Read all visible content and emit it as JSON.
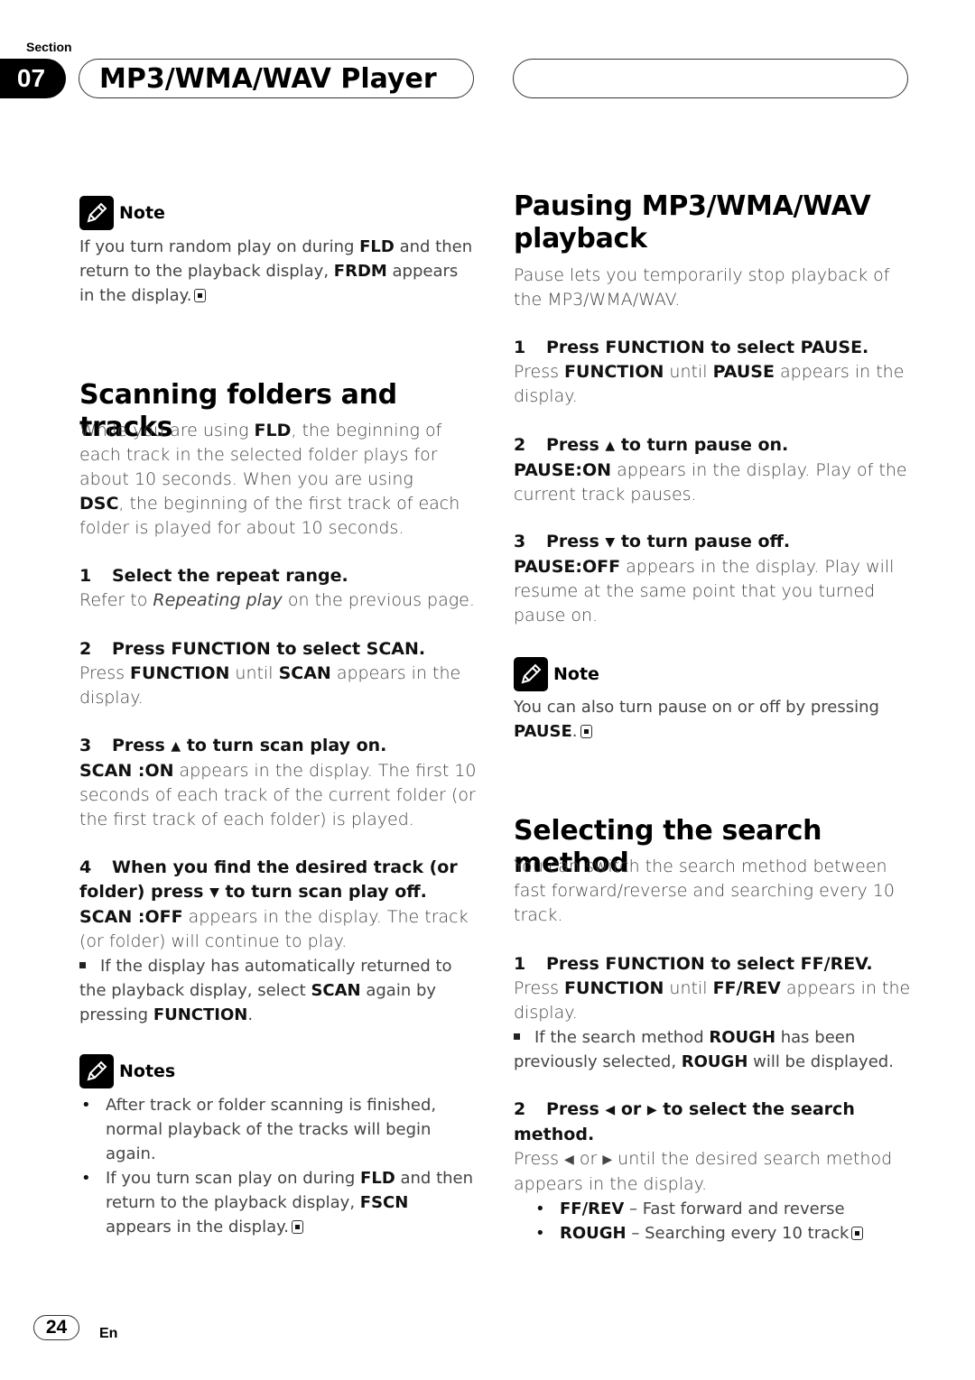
{
  "header": {
    "section_label": "Section",
    "section_number": "07",
    "title": "MP3/WMA/WAV Player"
  },
  "left": {
    "note1": {
      "heading": "Note",
      "parts": [
        "If you turn random play on during ",
        "FLD",
        " and then return to the playback display, ",
        "FRDM",
        " appears in the display."
      ]
    },
    "scan": {
      "heading": "Scanning folders and tracks",
      "intro": [
        "While you are using ",
        "FLD",
        ", the beginning of each track in the selected folder plays for about 10 seconds. When you are using ",
        "DSC",
        ", the beginning of the first track of each folder is played for about 10 seconds."
      ],
      "step1": {
        "num": "1",
        "title": "Select the repeat range.",
        "body_pre": "Refer to ",
        "body_em": "Repeating play",
        "body_post": " on the previous page."
      },
      "step2": {
        "num": "2",
        "title": "Press FUNCTION to select SCAN.",
        "body": [
          "Press ",
          "FUNCTION",
          " until ",
          "SCAN",
          " appears in the display."
        ]
      },
      "step3": {
        "num": "3",
        "title_pre": "Press ",
        "arrow": "▲",
        "title_post": " to turn scan play on.",
        "body": [
          "SCAN :ON",
          " appears in the display. The first 10 seconds of each track of the current folder (or the first track of each folder) is played."
        ]
      },
      "step4": {
        "num": "4",
        "title_pre": "When you find the desired track (or folder) press ",
        "arrow": "▼",
        "title_post": " to turn scan play off.",
        "body": [
          "SCAN :OFF",
          " appears in the display. The track (or folder) will continue to play."
        ],
        "tip": [
          "If the display has automatically returned to the playback display, select ",
          "SCAN",
          " again by pressing ",
          "FUNCTION",
          "."
        ]
      }
    },
    "notes2": {
      "heading": "Notes",
      "items": [
        {
          "parts": [
            "After track or folder scanning is finished, normal playback of the tracks will begin again."
          ]
        },
        {
          "parts": [
            "If you turn scan play on during ",
            "FLD",
            " and then return to the playback display, ",
            "FSCN",
            " appears in the display."
          ]
        }
      ]
    }
  },
  "right": {
    "pause": {
      "heading": "Pausing MP3/WMA/WAV playback",
      "intro": "Pause lets you temporarily stop playback of the MP3/WMA/WAV.",
      "step1": {
        "num": "1",
        "title": "Press FUNCTION to select PAUSE.",
        "body": [
          "Press ",
          "FUNCTION",
          " until ",
          "PAUSE",
          " appears in the display."
        ]
      },
      "step2": {
        "num": "2",
        "title_pre": "Press ",
        "arrow": "▲",
        "title_post": " to turn pause on.",
        "body": [
          "PAUSE:ON",
          " appears in the display. Play of the current track pauses."
        ]
      },
      "step3": {
        "num": "3",
        "title_pre": "Press ",
        "arrow": "▼",
        "title_post": " to turn pause off.",
        "body": [
          "PAUSE:OFF",
          " appears in the display. Play will resume at the same point that you turned pause on."
        ]
      }
    },
    "note": {
      "heading": "Note",
      "parts": [
        "You can also turn pause on or off by pressing ",
        "PAUSE",
        "."
      ]
    },
    "search": {
      "heading": "Selecting the search method",
      "intro": "You can switch the search method between fast forward/reverse and searching every 10 track.",
      "step1": {
        "num": "1",
        "title": "Press FUNCTION to select FF/REV.",
        "body": [
          "Press ",
          "FUNCTION",
          " until ",
          "FF/REV",
          " appears in the display."
        ],
        "tip": [
          "If the search method ",
          "ROUGH",
          " has been previously selected, ",
          "ROUGH",
          " will be displayed."
        ]
      },
      "step2": {
        "num": "2",
        "title_pre": "Press ",
        "left": "◀",
        "or": " or ",
        "right": "▶",
        "title_post": " to select the search method.",
        "body_pre": "Press ",
        "body_post": " until the desired search method appears in the display."
      },
      "options": [
        {
          "name": "FF/REV",
          "desc": " – Fast forward and reverse"
        },
        {
          "name": "ROUGH",
          "desc": " – Searching every 10 track"
        }
      ]
    }
  },
  "footer": {
    "page": "24",
    "lang": "En"
  }
}
